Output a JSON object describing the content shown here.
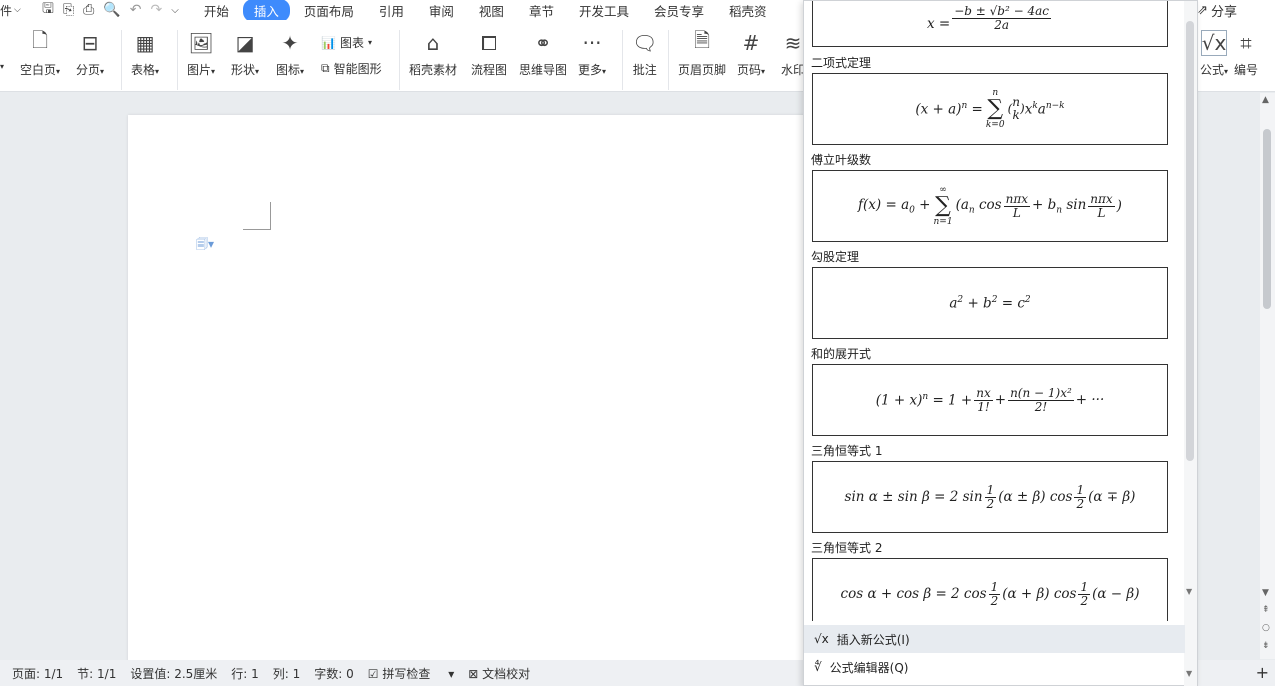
{
  "menubar": {
    "file_label": "件",
    "tabs": [
      "开始",
      "插入",
      "页面布局",
      "引用",
      "审阅",
      "视图",
      "章节",
      "开发工具",
      "会员专享",
      "稻壳资"
    ],
    "active_tab": "插入",
    "share_label": "分享"
  },
  "ribbon": {
    "blank_page": "空白页",
    "page_break": "分页",
    "table": "表格",
    "picture": "图片",
    "shape": "形状",
    "icon": "图标",
    "chart": "图表",
    "smart_shape": "智能图形",
    "docer_material": "稻壳素材",
    "flowchart": "流程图",
    "mindmap": "思维导图",
    "more": "更多",
    "comment": "批注",
    "header_footer": "页眉页脚",
    "page_number": "页码",
    "watermark": "水印",
    "formula": "公式",
    "numbering": "编号"
  },
  "formulas": {
    "items": [
      {
        "title": "",
        "label": "quadratic"
      },
      {
        "title": "二项式定理",
        "label": "binomial"
      },
      {
        "title": "傅立叶级数",
        "label": "fourier"
      },
      {
        "title": "勾股定理",
        "label": "pythagorean"
      },
      {
        "title": "和的展开式",
        "label": "expansion"
      },
      {
        "title": "三角恒等式 1",
        "label": "trig1"
      },
      {
        "title": "三角恒等式 2",
        "label": "trig2"
      }
    ],
    "insert_new": "插入新公式(I)",
    "editor": "公式编辑器(Q)"
  },
  "status": {
    "page": "页面: 1/1",
    "section": "节: 1/1",
    "setting": "设置值: 2.5厘米",
    "row": "行: 1",
    "col": "列: 1",
    "words": "字数: 0",
    "spellcheck": "拼写检查",
    "proofread": "文档校对"
  },
  "colors": {
    "accent": "#3e8bfc"
  }
}
